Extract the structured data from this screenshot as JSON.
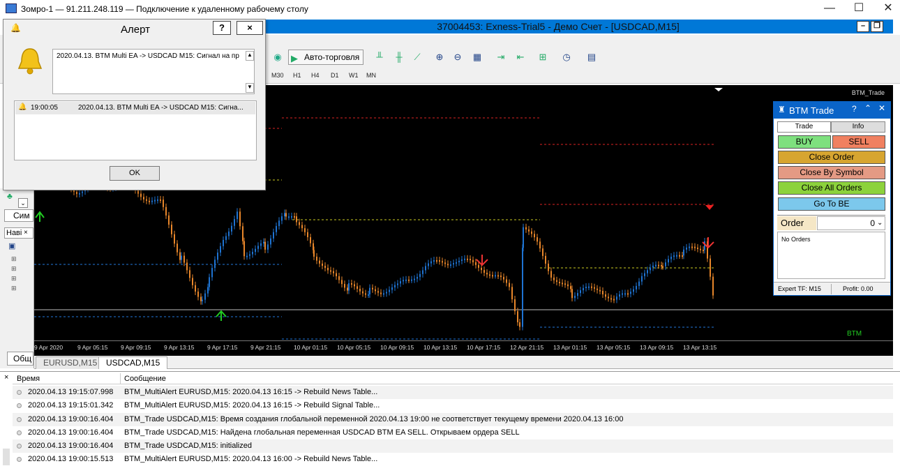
{
  "window": {
    "title": "Зомро-1 — 91.211.248.119 — Подключение к удаленному рабочему столу"
  },
  "mdi": {
    "title": "37004453: Exness-Trial5 - Демо Счет - [USDCAD,M15]"
  },
  "toolbar": {
    "autotrade_label": "Авто-торговля",
    "timeframes": [
      "M30",
      "H1",
      "H4",
      "D1",
      "W1",
      "MN"
    ]
  },
  "alert": {
    "title": "Алерт",
    "help_label": "?",
    "close_label": "×",
    "message": "2020.04.13. BTM Multi EA -> USDCAD M15: Сигнал на пр",
    "list_time": "19:00:05",
    "list_text": "2020.04.13. BTM Multi EA -> USDCAD M15: Сигна...",
    "ok_label": "OK"
  },
  "chart": {
    "indicator_label": "BTM_Trade",
    "watermark": "BTM",
    "time_labels": [
      "9 Apr 2020",
      "9 Apr 05:15",
      "9 Apr 09:15",
      "9 Apr 13:15",
      "9 Apr 17:15",
      "9 Apr 21:15",
      "10 Apr 01:15",
      "10 Apr 05:15",
      "10 Apr 09:15",
      "10 Apr 13:15",
      "10 Apr 17:15",
      "12 Apr 21:15",
      "13 Apr 01:15",
      "13 Apr 05:15",
      "13 Apr 09:15",
      "13 Apr 13:15"
    ],
    "colors": {
      "bull": "#1e73d2",
      "bear": "#e8862a",
      "bg": "#000000"
    }
  },
  "btm": {
    "title": "BTM Trade",
    "tab_trade": "Trade",
    "tab_info": "Info",
    "buy": "BUY",
    "sell": "SELL",
    "close_order": "Close Order",
    "close_by_symbol": "Close By Symbol",
    "close_all": "Close All Orders",
    "go_to_be": "Go To BE",
    "order_label": "Order",
    "order_value": "0",
    "no_orders": "No Orders",
    "expert_tf": "Expert TF:  M15",
    "profit": "Profit: 0.00"
  },
  "left": {
    "tab_symbols": "Сим",
    "nav_title": "Наві",
    "general": "Общ"
  },
  "tabs": [
    "EURUSD,M15",
    "USDCAD,M15"
  ],
  "log": {
    "col_time": "Время",
    "col_msg": "Сообщение",
    "rows": [
      {
        "time": "2020.04.13 19:15:07.998",
        "msg": "BTM_MultiAlert EURUSD,M15: 2020.04.13 16:15 -> Rebuild News Table..."
      },
      {
        "time": "2020.04.13 19:15:01.342",
        "msg": "BTM_MultiAlert EURUSD,M15: 2020.04.13 16:15 -> Rebuild Signal Table..."
      },
      {
        "time": "2020.04.13 19:00:16.404",
        "msg": "BTM_Trade USDCAD,M15: Время создания глобальной переменной 2020.04.13 19:00 не соответствует текущему времени 2020.04.13 16:00"
      },
      {
        "time": "2020.04.13 19:00:16.404",
        "msg": "BTM_Trade USDCAD,M15: Найдена глобальная переменная USDCAD BTM EA SELL. Открываем ордера SELL"
      },
      {
        "time": "2020.04.13 19:00:16.404",
        "msg": "BTM_Trade USDCAD,M15: initialized"
      },
      {
        "time": "2020.04.13 19:00:15.513",
        "msg": "BTM_MultiAlert EURUSD,M15: 2020.04.13 16:00 -> Rebuild News Table..."
      }
    ]
  }
}
